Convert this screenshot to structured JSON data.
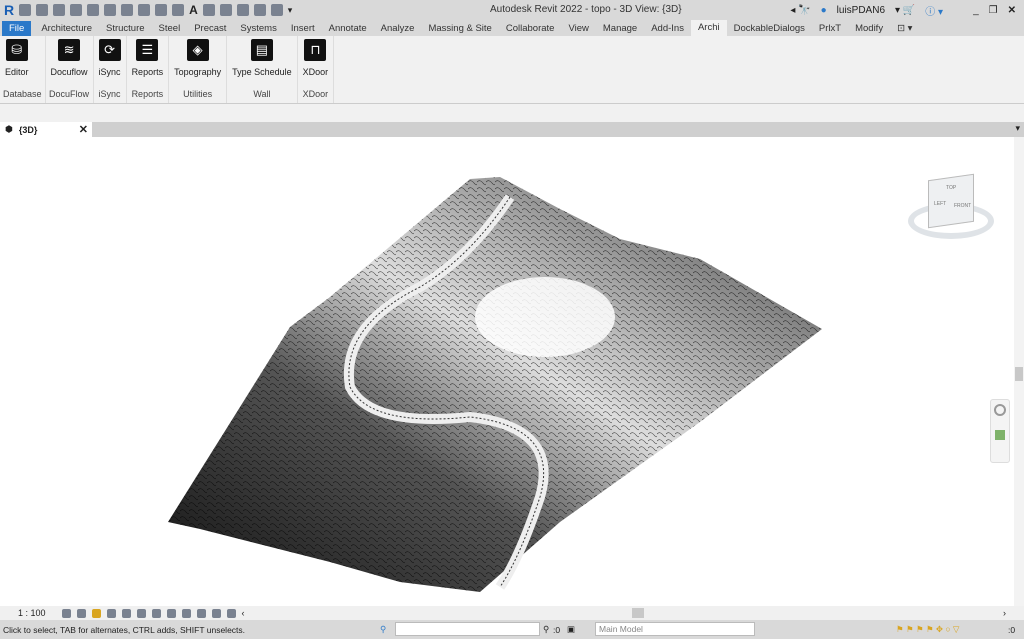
{
  "app": {
    "title": "Autodesk Revit 2022 - topo - 3D View: {3D}",
    "user": "luisPDAN6"
  },
  "tabs": [
    "File",
    "Architecture",
    "Structure",
    "Steel",
    "Precast",
    "Systems",
    "Insert",
    "Annotate",
    "Analyze",
    "Massing & Site",
    "Collaborate",
    "View",
    "Manage",
    "Add-Ins",
    "Archi",
    "DockableDialogs",
    "PrlxT",
    "Modify"
  ],
  "active_tab": "Archi",
  "ribbon": {
    "panels": [
      {
        "label": "Database",
        "buttons": [
          {
            "label": "Editor",
            "icon": "database-icon"
          }
        ]
      },
      {
        "label": "DocuFlow",
        "buttons": [
          {
            "label": "Docuflow",
            "icon": "waves-icon"
          }
        ]
      },
      {
        "label": "iSync",
        "buttons": [
          {
            "label": "iSync",
            "icon": "sync-icon"
          }
        ]
      },
      {
        "label": "Reports",
        "buttons": [
          {
            "label": "Reports",
            "icon": "report-icon"
          }
        ]
      },
      {
        "label": "Utilities",
        "buttons": [
          {
            "label": "Topography",
            "icon": "topography-icon"
          }
        ]
      },
      {
        "label": "Wall",
        "buttons": [
          {
            "label": "Type Schedule",
            "icon": "schedule-icon"
          }
        ]
      },
      {
        "label": "XDoor",
        "buttons": [
          {
            "label": "XDoor",
            "icon": "door-icon"
          }
        ]
      }
    ]
  },
  "view_tab": {
    "label": "{3D}"
  },
  "viewcube": {
    "left": "LEFT",
    "front": "FRONT",
    "top": "TOP"
  },
  "view_bar": {
    "scale": "1 : 100"
  },
  "status": {
    "message": "Click to select, TAB for alternates, CTRL adds, SHIFT unselects.",
    "workset_count": ":0",
    "model": "Main Model",
    "filter_count": ":0"
  }
}
